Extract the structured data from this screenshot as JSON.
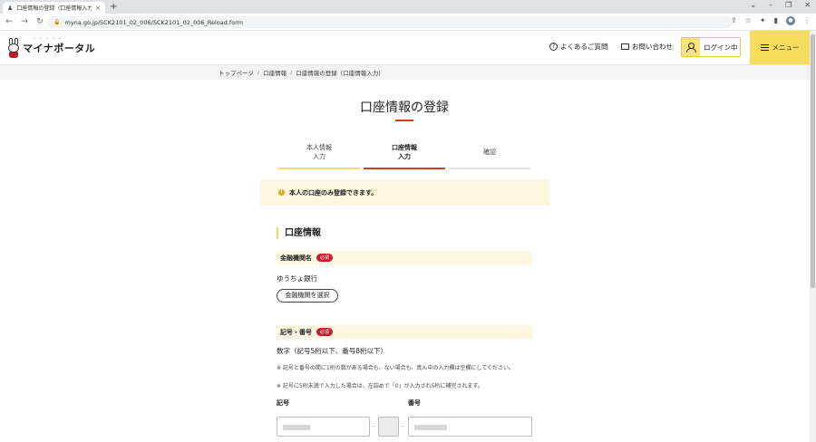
{
  "browser": {
    "tab_title": "口座情報の登録（口座情報入力）",
    "tab_close": "×",
    "new_tab": "+",
    "url": "myna.go.jp/SCK2101_02_006/SCK2101_02_006_Reload.form",
    "nav": {
      "back": "←",
      "forward": "→",
      "reload": "↻"
    },
    "window_controls": {
      "chevron": "⌄",
      "minimize": "–",
      "restore": "❐",
      "close": "✕"
    },
    "toolbar_icons": {
      "share": "⇪",
      "bookmark": "☆",
      "extensions": "✦",
      "sidepanel": "▮",
      "more": "⋮"
    }
  },
  "header": {
    "logo_text": "マイナポータル",
    "logo_ruby": "・・・・・",
    "faq_label": "よくあるご質問",
    "faq_icon": "?",
    "contact_label": "お問い合わせ",
    "login_label": "ログイン中",
    "menu_label": "メニュー"
  },
  "breadcrumb": {
    "items": [
      "トップページ",
      "口座情報",
      "口座情報の登録（口座情報入力）"
    ],
    "separator": "/"
  },
  "page": {
    "title": "口座情報の登録"
  },
  "steps": [
    {
      "line1": "本人情報",
      "line2": "入力",
      "state": "done"
    },
    {
      "line1": "口座情報",
      "line2": "入力",
      "state": "active"
    },
    {
      "line1": "確認",
      "line2": "",
      "state": "todo"
    }
  ],
  "notice": {
    "icon": "i",
    "text": "本人の口座のみ登録できます。"
  },
  "section": {
    "title": "口座情報"
  },
  "bank": {
    "label": "金融機関名",
    "required": "必須",
    "value": "ゆうちょ銀行",
    "select_button": "金融機関を選択"
  },
  "number": {
    "label": "記号・番号",
    "required": "必須",
    "digits_note": "数字（記号5桁以下、番号8桁以下）",
    "note1": "※ 記号と番号の間に1桁の数がある場合も、ない場合も、真ん中の入力欄は空欄にしてください。",
    "note2": "※ 記号に5桁未満で入力した場合は、左詰めで「0」が入力され5桁に補完されます。",
    "symbol_label": "記号",
    "number_label": "番号",
    "dash": "–"
  },
  "colors": {
    "accent_yellow": "#f8dc5d",
    "accent_red": "#d43d1f",
    "required_red": "#c91c30",
    "notice_bg": "#fdf7df"
  }
}
